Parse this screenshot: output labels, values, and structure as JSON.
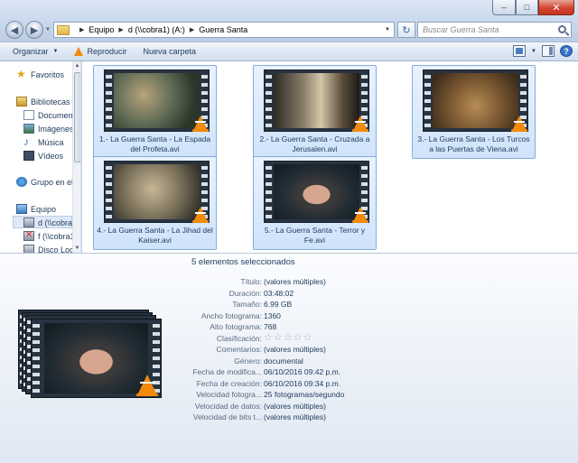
{
  "window": {
    "buttons": {
      "minimize": "–",
      "maximize": "□",
      "close": "✕"
    }
  },
  "address": {
    "crumbs": [
      "Equipo",
      "d (\\\\cobra1) (A:)",
      "Guerra Santa"
    ]
  },
  "search": {
    "placeholder": "Buscar Guerra Santa"
  },
  "toolbar": {
    "organize_label": "Organizar",
    "play_label": "Reproducir",
    "new_folder_label": "Nueva carpeta",
    "help_label": "?"
  },
  "nav": {
    "favorites": "Favoritos",
    "libraries": "Bibliotecas",
    "documents": "Documen",
    "images": "Imágenes",
    "music": "Música",
    "videos": "Vídeos",
    "homegroup": "Grupo en el",
    "computer": "Equipo",
    "drive_d": "d (\\\\cobra",
    "drive_f": "f (\\\\cobra1",
    "drive_local": "Disco Loc"
  },
  "files": [
    {
      "label": "1.- La Guerra Santa - La Espada del Profeta.avi"
    },
    {
      "label": "2.- La Guerra Santa - Cruzada a Jerusalen.avi"
    },
    {
      "label": "3.- La Guerra Santa - Los Turcos a las Puertas de Viena.avi"
    },
    {
      "label": "4.- La Guerra Santa - La Jihad del Kaiser.avi"
    },
    {
      "label": "5.- La Guerra Santa - Terror y Fe.avi"
    }
  ],
  "details": {
    "summary": "5 elementos seleccionados",
    "properties": [
      {
        "label": "Título:",
        "value": "(valores múltiples)"
      },
      {
        "label": "Duración:",
        "value": "03:48:02"
      },
      {
        "label": "Tamaño:",
        "value": "6.99 GB"
      },
      {
        "label": "Ancho fotograma:",
        "value": "1360"
      },
      {
        "label": "Alto fotograma:",
        "value": "768"
      },
      {
        "label": "Clasificación:",
        "value": ""
      },
      {
        "label": "Comentarios:",
        "value": "(valores múltiples)"
      },
      {
        "label": "Género:",
        "value": "documental"
      },
      {
        "label": "Fecha de modifica...",
        "value": "06/10/2016 09:42 p.m."
      },
      {
        "label": "Fecha de creación:",
        "value": "06/10/2016 09:34 p.m."
      },
      {
        "label": "Velocidad fotogra...",
        "value": "25 fotogramas/segundo"
      },
      {
        "label": "Velocidad de datos:",
        "value": "(valores múltiples)"
      },
      {
        "label": "Velocidad de bits t...",
        "value": "(valores múltiples)"
      }
    ],
    "rating": 0,
    "rating_max": 5
  },
  "colors": {
    "selection_fill": "#cfe3fb",
    "selection_border": "#84acdd",
    "vlc_orange": "#f28a0c"
  }
}
